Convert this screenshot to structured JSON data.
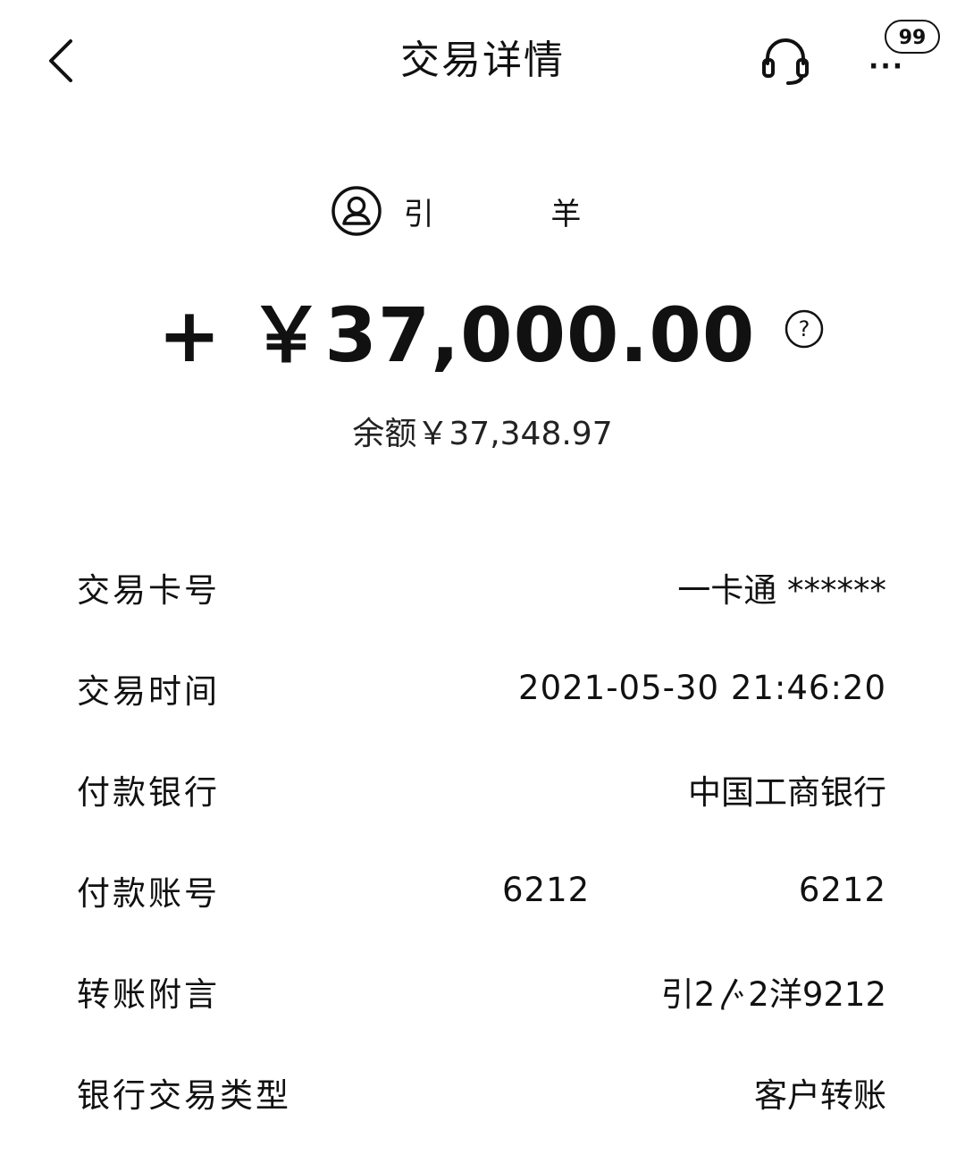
{
  "header": {
    "title": "交易详情",
    "back_icon": "chevron-left-icon",
    "service_icon": "headset-icon",
    "more_dots": "···",
    "message_badge": "99"
  },
  "counterparty": {
    "name": "引 羊",
    "avatar_icon": "user-circle-icon"
  },
  "amount": {
    "value": "+ ￥37,000.00",
    "help_icon": "question-circle-icon"
  },
  "balance": "余额￥37,348.97",
  "details": [
    {
      "label": "交易卡号",
      "value": "一卡通 ****** "
    },
    {
      "label": "交易时间",
      "value": "2021-05-30 21:46:20"
    },
    {
      "label": "付款银行",
      "value": "中国工商银行"
    },
    {
      "label": "付款账号",
      "value_left": "6212",
      "value_right": "6212"
    },
    {
      "label": "转账附言",
      "value": "引2〴2洋9212"
    },
    {
      "label": "银行交易类型",
      "value": "客户转账"
    }
  ],
  "colors": {
    "text": "#111111",
    "background": "#ffffff"
  }
}
